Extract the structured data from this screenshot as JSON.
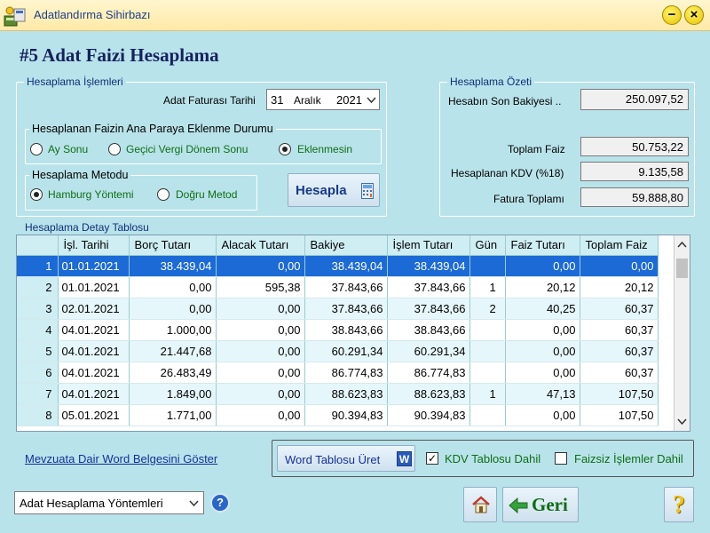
{
  "window": {
    "title": "Adatlandırma Sihirbazı",
    "minimize": "−",
    "close": "×"
  },
  "page_title": "#5 Adat Faizi Hesaplama",
  "operations": {
    "legend": "Hesaplama İşlemleri",
    "invoice_date_label": "Adat Faturası Tarihi",
    "date": {
      "day": "31",
      "month": "Aralık",
      "year": "2021"
    },
    "interest_group": {
      "legend": "Hesaplanan Faizin Ana Paraya Eklenme Durumu",
      "options": [
        "Ay Sonu",
        "Geçici Vergi Dönem Sonu",
        "Eklenmesin"
      ],
      "selected": 2
    },
    "method_group": {
      "legend": "Hesaplama Metodu",
      "options": [
        "Hamburg Yöntemi",
        "Doğru Metod"
      ],
      "selected": 0
    },
    "calc_button": "Hesapla"
  },
  "summary": {
    "legend": "Hesaplama Özeti",
    "last_balance_label": "Hesabın Son Bakiyesi ..",
    "last_balance": "250.097,52",
    "total_interest_label": "Toplam Faiz",
    "total_interest": "50.753,22",
    "kdv_label": "Hesaplanan KDV (%18)",
    "kdv": "9.135,58",
    "invoice_total_label": "Fatura Toplamı",
    "invoice_total": "59.888,80"
  },
  "detail_table": {
    "legend": "Hesaplama Detay Tablosu",
    "columns": [
      "",
      "İşl. Tarihi",
      "Borç Tutarı",
      "Alacak Tutarı",
      "Bakiye",
      "İşlem Tutarı",
      "Gün",
      "Faiz Tutarı",
      "Toplam Faiz"
    ],
    "rows": [
      [
        "1",
        "01.01.2021",
        "38.439,04",
        "0,00",
        "38.439,04",
        "38.439,04",
        "",
        "0,00",
        "0,00"
      ],
      [
        "2",
        "01.01.2021",
        "0,00",
        "595,38",
        "37.843,66",
        "37.843,66",
        "1",
        "20,12",
        "20,12"
      ],
      [
        "3",
        "02.01.2021",
        "0,00",
        "0,00",
        "37.843,66",
        "37.843,66",
        "2",
        "40,25",
        "60,37"
      ],
      [
        "4",
        "04.01.2021",
        "1.000,00",
        "0,00",
        "38.843,66",
        "38.843,66",
        "",
        "0,00",
        "60,37"
      ],
      [
        "5",
        "04.01.2021",
        "21.447,68",
        "0,00",
        "60.291,34",
        "60.291,34",
        "",
        "0,00",
        "60,37"
      ],
      [
        "6",
        "04.01.2021",
        "26.483,49",
        "0,00",
        "86.774,83",
        "86.774,83",
        "",
        "0,00",
        "60,37"
      ],
      [
        "7",
        "04.01.2021",
        "1.849,00",
        "0,00",
        "88.623,83",
        "88.623,83",
        "1",
        "47,13",
        "107,50"
      ],
      [
        "8",
        "05.01.2021",
        "1.771,00",
        "0,00",
        "90.394,83",
        "90.394,83",
        "",
        "0,00",
        "107,50"
      ]
    ]
  },
  "footer": {
    "word_link": "Mevzuata Dair Word Belgesini Göster",
    "word_table_button": "Word Tablosu Üret",
    "kdv_check_label": "KDV Tablosu Dahil",
    "kdv_checked": true,
    "no_interest_check_label": "Faizsiz İşlemler Dahil",
    "no_interest_checked": false,
    "method_select": "Adat Hesaplama Yöntemleri",
    "back_button": "Geri",
    "help_mark": "?",
    "question_mark": "?"
  }
}
